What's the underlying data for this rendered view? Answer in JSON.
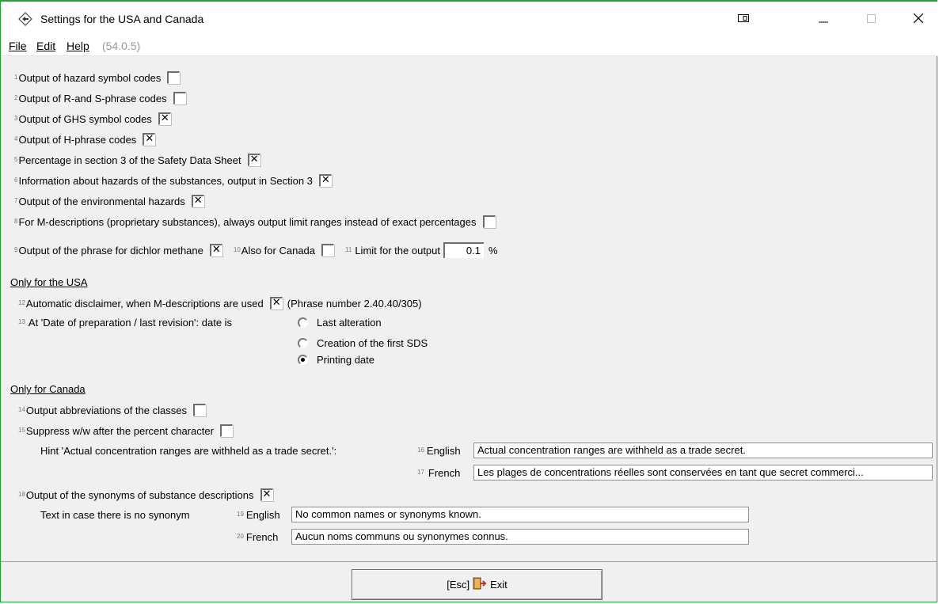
{
  "window": {
    "title": "Settings for the USA and Canada"
  },
  "menu": {
    "file": "File",
    "edit": "Edit",
    "help": "Help",
    "version": "(54.0.5)"
  },
  "options": [
    {
      "num": "1",
      "label": "Output of hazard symbol codes",
      "checked": false
    },
    {
      "num": "2",
      "label": "Output of R-and S-phrase codes",
      "checked": false
    },
    {
      "num": "3",
      "label": "Output of GHS symbol codes",
      "checked": true
    },
    {
      "num": "4",
      "label": "Output of H-phrase codes",
      "checked": true
    },
    {
      "num": "5",
      "label": "Percentage in section 3 of the Safety Data Sheet",
      "checked": true
    },
    {
      "num": "6",
      "label": "Information about hazards of the substances, output in Section 3",
      "checked": true
    },
    {
      "num": "7",
      "label": "Output of the environmental hazards",
      "checked": true
    },
    {
      "num": "8",
      "label": "For M-descriptions (proprietary substances), always output limit ranges instead of exact percentages",
      "checked": false
    }
  ],
  "row9": {
    "num": "9",
    "label": "Output of the phrase for dichlor methane",
    "checked": true,
    "num10": "10",
    "label10": "Also for Canada",
    "checked10": false,
    "num11": "11",
    "label11": "Limit for the output",
    "value11": "0.1",
    "unit11": "%"
  },
  "usa": {
    "heading": "Only for the USA",
    "num12": "12",
    "label12": "Automatic disclaimer, when M-descriptions are used",
    "checked12": true,
    "phrase12": "(Phrase number 2.40.40/305)",
    "num13": "13",
    "label13": "At 'Date of preparation / last revision': date is",
    "radios": [
      {
        "label": "Last alteration",
        "checked": false
      },
      {
        "label": "Creation of the first SDS",
        "checked": false
      },
      {
        "label": "Printing date",
        "checked": true
      }
    ]
  },
  "canada": {
    "heading": "Only for Canada",
    "num14": "14",
    "label14": "Output abbreviations of the classes",
    "checked14": false,
    "num15": "15",
    "label15": "Suppress w/w after the percent character",
    "checked15": false,
    "hint_label": "Hint 'Actual concentration ranges are withheld as a trade secret.':",
    "num16": "16",
    "lang16": "English",
    "value16": "Actual concentration ranges are withheld as a trade secret.",
    "num17": "17",
    "lang17": "French",
    "value17": "Les plages de concentrations réelles sont conservées en tant que secret commerci...",
    "num18": "18",
    "label18": "Output of the synonyms of substance descriptions",
    "checked18": true,
    "nosyn_label": "Text in case there is no synonym",
    "num19": "19",
    "lang19": "English",
    "value19": "No common names or synonyms known.",
    "num20": "20",
    "lang20": "French",
    "value20": "Aucun noms communs ou synonymes connus."
  },
  "exit": {
    "shortcut": "[Esc]",
    "label": "Exit"
  }
}
